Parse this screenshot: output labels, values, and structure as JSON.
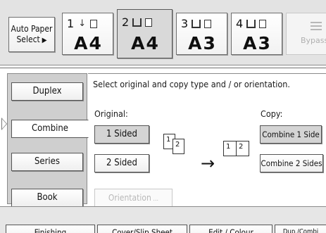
{
  "paper_select": {
    "auto": {
      "line1": "Auto Paper",
      "line2": "Select"
    },
    "trays": [
      {
        "number": "1",
        "size": "A4",
        "selected": false
      },
      {
        "number": "2",
        "size": "A4",
        "selected": true
      },
      {
        "number": "3",
        "size": "A3",
        "selected": false
      },
      {
        "number": "4",
        "size": "A3",
        "selected": false
      }
    ],
    "bypass": {
      "label": "Bypass"
    }
  },
  "side_menu": {
    "items": [
      {
        "label": "Duplex",
        "active": false
      },
      {
        "label": "Combine",
        "active": true
      },
      {
        "label": "Series",
        "active": false
      },
      {
        "label": "Book",
        "active": false
      }
    ]
  },
  "combine_panel": {
    "instruction": "Select original and copy type and / or orientation.",
    "original_label": "Original:",
    "copy_label": "Copy:",
    "original_options": [
      {
        "label": "1 Sided",
        "selected": true
      },
      {
        "label": "2 Sided",
        "selected": false
      }
    ],
    "copy_options": [
      {
        "label": "Combine 1 Side",
        "selected": true
      },
      {
        "label": "Combine 2 Sides",
        "selected": false
      }
    ],
    "orientation_label": "Orientation",
    "diagram": {
      "original_pages": [
        "1",
        "2"
      ],
      "copy_pages": [
        "1",
        "2"
      ]
    }
  },
  "bottom_tabs": [
    "Finishing",
    "Cover/Slip Sheet",
    "Edit / Colour",
    "Dup./Combi"
  ]
}
